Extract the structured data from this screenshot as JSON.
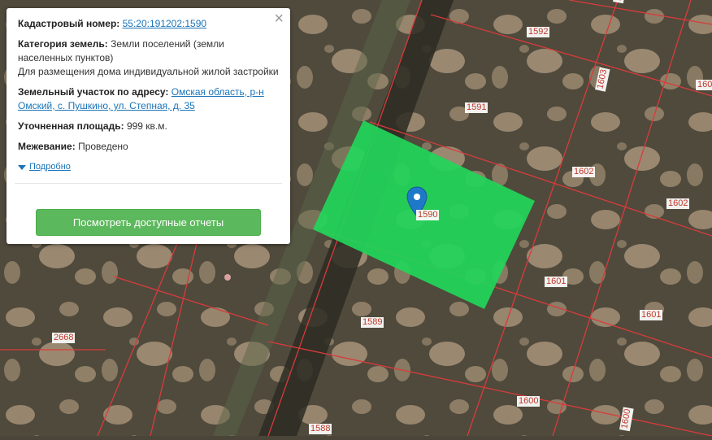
{
  "popup": {
    "close_symbol": "×",
    "cadastral_label": "Кадастровый номер:",
    "cadastral_value": "55:20:191202:1590",
    "category_label": "Категория земель:",
    "category_value": "Земли поселений (земли населенных пунктов)",
    "category_usage": "Для размещения дома индивидуальной жилой застройки",
    "address_label": "Земельный участок по адресу:",
    "address_value": "Омская область, р-н Омский, с. Пушкино, ул. Степная, д. 35",
    "area_label": "Уточненная площадь:",
    "area_value": "999 кв.м.",
    "survey_label": "Межевание:",
    "survey_value": "Проведено",
    "details_link": "Подробно",
    "button_label": "Посмотреть доступные отчеты"
  },
  "map": {
    "plot_labels": [
      "1592",
      "1592",
      "1603",
      "160",
      "1591",
      "1602",
      "1602",
      "1590",
      "1601",
      "1601",
      "1589",
      "2668",
      "1600",
      "1600",
      "1588"
    ],
    "selected_fill": "#22d65a",
    "boundary_color": "#d93b3b",
    "marker_color": "#1f79c9"
  }
}
